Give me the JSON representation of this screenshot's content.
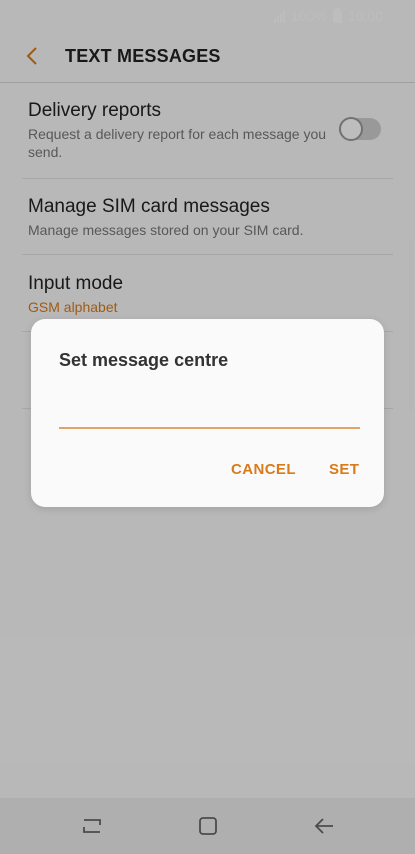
{
  "status": {
    "battery": "100%",
    "time": "10:00"
  },
  "header": {
    "title": "TEXT MESSAGES"
  },
  "settings": {
    "delivery": {
      "title": "Delivery reports",
      "subtitle": "Request a delivery report for each message you send."
    },
    "sim": {
      "title": "Manage SIM card messages",
      "subtitle": "Manage messages stored on your SIM card."
    },
    "input": {
      "title": "Input mode",
      "value": "GSM alphabet"
    }
  },
  "dialog": {
    "title": "Set message centre",
    "field_value": "",
    "cancel": "CANCEL",
    "set": "SET"
  },
  "colors": {
    "accent": "#d87b1a"
  },
  "icons": {
    "back": "back-chevron-icon",
    "recents": "recents-icon",
    "home": "home-icon",
    "nav_back": "nav-back-icon"
  }
}
